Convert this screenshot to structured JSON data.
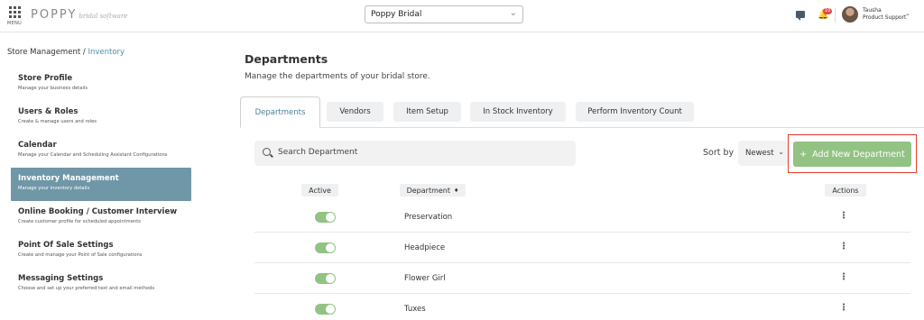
{
  "header": {
    "menu_label": "MENU",
    "brand": "POPPY",
    "brand_sub": "bridal software",
    "store_select": "Poppy Bridal",
    "notification_badge": "10",
    "user_name": "Tausha",
    "user_role": "Product Support"
  },
  "breadcrumb": {
    "root": "Store Management",
    "separator": "/",
    "current": "Inventory"
  },
  "sidebar": {
    "items": [
      {
        "title": "Store Profile",
        "desc": "Manage your business details"
      },
      {
        "title": "Users & Roles",
        "desc": "Create & manage users and roles"
      },
      {
        "title": "Calendar",
        "desc": "Manage your Calendar and Scheduling Assistant Configurations"
      },
      {
        "title": "Inventory Management",
        "desc": "Manage your inventory details"
      },
      {
        "title": "Online Booking / Customer Interview",
        "desc": "Create customer profile for scheduled appointments"
      },
      {
        "title": "Point Of Sale Settings",
        "desc": "Create and manage your Point of Sale configurations"
      },
      {
        "title": "Messaging Settings",
        "desc": "Choose and set up your preferred text and email methods"
      }
    ]
  },
  "main": {
    "title": "Departments",
    "subtitle": "Manage the departments of your bridal store.",
    "tabs": [
      "Departments",
      "Vendors",
      "Item Setup",
      "In Stock Inventory",
      "Perform Inventory Count"
    ],
    "search_placeholder": "Search Department",
    "sort_label": "Sort by",
    "sort_value": "Newest",
    "add_button": "Add New Department",
    "add_icon": "+"
  },
  "table": {
    "headers": {
      "active": "Active",
      "department": "Department",
      "department_sort_icon": "♦",
      "actions": "Actions"
    },
    "rows": [
      {
        "name": "Preservation",
        "active": true
      },
      {
        "name": "Headpiece",
        "active": true
      },
      {
        "name": "Flower Girl",
        "active": true
      },
      {
        "name": "Tuxes",
        "active": true
      }
    ]
  },
  "colors": {
    "accent_green": "#92c383",
    "active_sidebar": "#6f97a8",
    "highlight_red": "#e23b2b",
    "link_blue": "#4b8fb0"
  }
}
